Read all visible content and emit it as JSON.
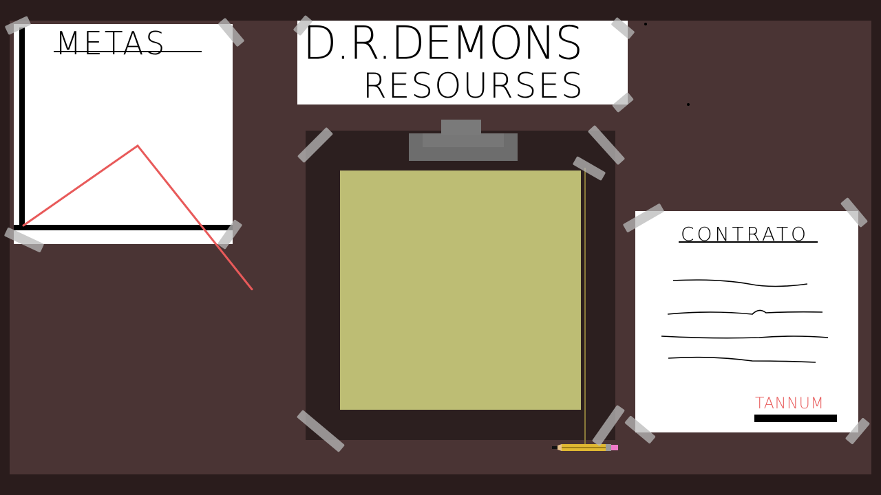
{
  "metas": {
    "title": "METAS",
    "chart_data": {
      "type": "line",
      "title": "",
      "xlabel": "",
      "ylabel": "",
      "x": [
        0,
        1,
        2
      ],
      "series": [
        {
          "values": [
            0,
            1,
            -0.8
          ]
        }
      ],
      "line_color": "#e85a5a"
    }
  },
  "banner": {
    "line1": "D.R.DEMONS",
    "line2": "RESOURSES"
  },
  "contract": {
    "title": "CONTRATO",
    "signature": "TANNUM"
  },
  "colors": {
    "background": "#2a1c1c",
    "board": "#4a3434",
    "clipboard": "#2c1f1f",
    "clip_paper": "#bdbd74",
    "signature": "#e85a5a"
  },
  "icons": {
    "pencil": "pencil-icon"
  }
}
